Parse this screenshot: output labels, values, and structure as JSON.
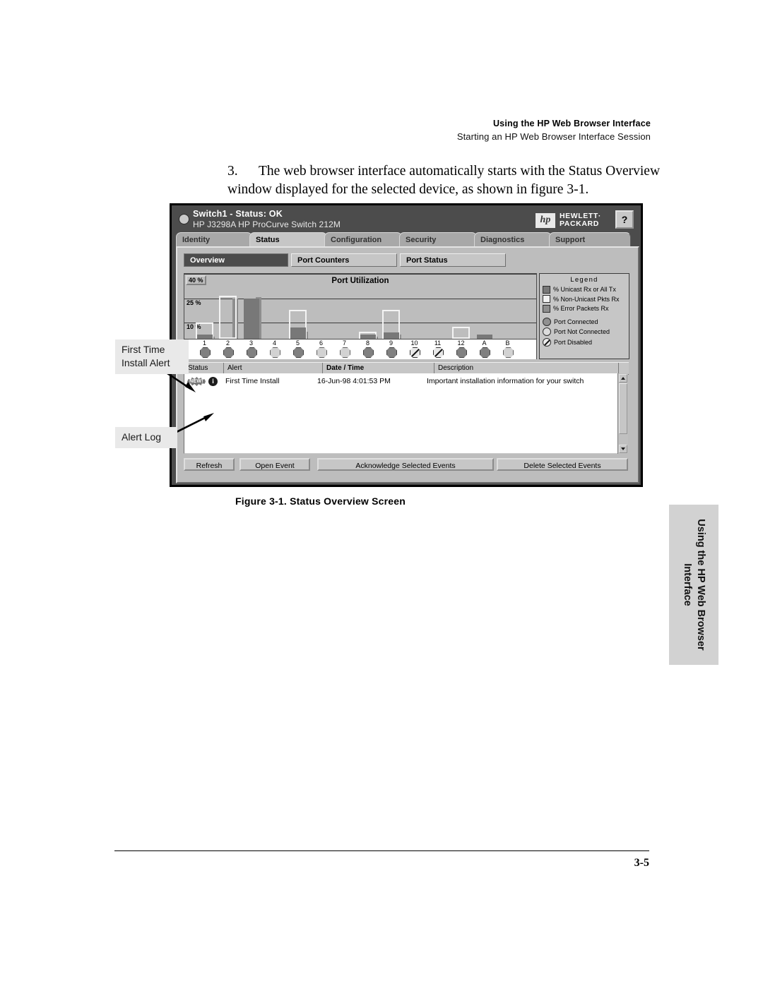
{
  "running_head": {
    "line1": "Using the HP Web Browser Interface",
    "line2": "Starting an HP Web Browser Interface Session"
  },
  "step": {
    "number": "3.",
    "text": "The web browser interface automatically starts with the Status Overview window displayed for the selected device, as shown in figure 3-1."
  },
  "window": {
    "status_led": "status-led",
    "title": "Switch1 - Status:  OK",
    "subtitle": "HP J3298A HP ProCurve Switch 212M",
    "logo": {
      "mark": "hp",
      "line1": "HEWLETT·",
      "line2": "PACKARD"
    },
    "help_button": "?",
    "tabs": [
      {
        "label": "Identity",
        "active": false
      },
      {
        "label": "Status",
        "active": true
      },
      {
        "label": "Configuration",
        "active": false
      },
      {
        "label": "Security",
        "active": false
      },
      {
        "label": "Diagnostics",
        "active": false
      },
      {
        "label": "Support",
        "active": false
      }
    ],
    "subtabs": [
      {
        "label": "Overview",
        "active": true
      },
      {
        "label": "Port Counters",
        "active": false
      },
      {
        "label": "Port Status",
        "active": false
      }
    ],
    "legend": {
      "title": "Legend",
      "items": [
        {
          "label": "% Unicast Rx or All Tx",
          "marker": "square-dark"
        },
        {
          "label": "% Non-Unicast Pkts Rx",
          "marker": "square-white"
        },
        {
          "label": "% Error Packets Rx",
          "marker": "square-mid"
        },
        {
          "label": "Port Connected",
          "marker": "circle-dark"
        },
        {
          "label": "Port Not Connected",
          "marker": "circle-light"
        },
        {
          "label": "Port Disabled",
          "marker": "circle-slashed"
        }
      ]
    },
    "alert_table": {
      "columns": [
        "Status",
        "Alert",
        "Date / Time",
        "Description"
      ],
      "sorted_column": "Date / Time",
      "rows": [
        {
          "status_badge": "NEW!",
          "status_icon": "info-icon",
          "alert": "First Time Install",
          "datetime": "16-Jun-98 4:01:53 PM",
          "description": "Important installation information for your switch"
        }
      ]
    },
    "buttons": [
      {
        "label": "Refresh"
      },
      {
        "label": "Open Event"
      },
      {
        "label": "Acknowledge Selected Events"
      },
      {
        "label": "Delete Selected Events"
      }
    ]
  },
  "chart_data": {
    "type": "bar",
    "title": "Port Utilization",
    "xlabel": "",
    "ylabel": "",
    "ylim": [
      0,
      40
    ],
    "yticks": [
      10,
      25,
      40
    ],
    "ytick_labels": [
      "10 %",
      "25 %",
      "40 %"
    ],
    "grid": true,
    "legend_position": "right",
    "categories": [
      "1",
      "2",
      "3",
      "4",
      "5",
      "6",
      "7",
      "8",
      "9",
      "10",
      "11",
      "12",
      "A",
      "B"
    ],
    "series": [
      {
        "name": "% Unicast Rx or All Tx",
        "color": "#787878",
        "values": [
          2.5,
          0,
          25,
          0,
          7,
          0,
          0,
          2.5,
          4,
          0,
          0,
          0,
          2.5,
          0
        ]
      },
      {
        "name": "% Non-Unicast Pkts Rx",
        "color": "#f4f4f4",
        "values": [
          10,
          26.5,
          0,
          0,
          18,
          0,
          0,
          4.5,
          18,
          0,
          0,
          7.5,
          0,
          0
        ]
      },
      {
        "name": "% Error Packets Rx",
        "color": "#8e8e8e",
        "values": [
          1.5,
          25,
          25.5,
          0,
          4.5,
          0,
          0,
          1.5,
          2.5,
          0,
          0,
          0,
          0,
          0
        ]
      }
    ],
    "port_states": [
      "connected",
      "connected",
      "connected",
      "not-connected",
      "connected",
      "not-connected",
      "not-connected",
      "connected",
      "connected",
      "disabled",
      "disabled",
      "connected",
      "connected",
      "not-connected"
    ]
  },
  "callouts": [
    {
      "text": "First Time\nInstall Alert"
    },
    {
      "text": "Alert Log"
    }
  ],
  "caption": "Figure 3-1.   Status Overview Screen",
  "side_tab": {
    "line1": "Using the HP Web Browser",
    "line2": "Interface"
  },
  "page_number": "3-5"
}
